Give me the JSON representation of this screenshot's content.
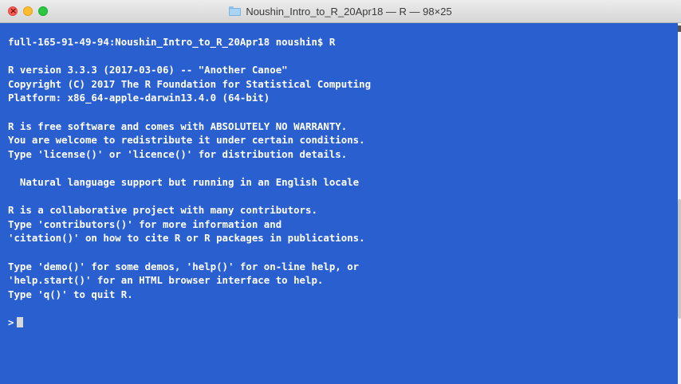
{
  "window": {
    "title": "Noushin_Intro_to_R_20Apr18 — R — 98×25",
    "title_icon": "folder-icon"
  },
  "terminal": {
    "lines": [
      "full-165-91-49-94:Noushin_Intro_to_R_20Apr18 noushin$ R",
      "",
      "R version 3.3.3 (2017-03-06) -- \"Another Canoe\"",
      "Copyright (C) 2017 The R Foundation for Statistical Computing",
      "Platform: x86_64-apple-darwin13.4.0 (64-bit)",
      "",
      "R is free software and comes with ABSOLUTELY NO WARRANTY.",
      "You are welcome to redistribute it under certain conditions.",
      "Type 'license()' or 'licence()' for distribution details.",
      "",
      "  Natural language support but running in an English locale",
      "",
      "R is a collaborative project with many contributors.",
      "Type 'contributors()' for more information and",
      "'citation()' on how to cite R or R packages in publications.",
      "",
      "Type 'demo()' for some demos, 'help()' for on-line help, or",
      "'help.start()' for an HTML browser interface to help.",
      "Type 'q()' to quit R.",
      ""
    ],
    "prompt": ">"
  },
  "colors": {
    "background": "#2a5fd0",
    "text": "#ffffff",
    "cursor": "#d8d8d8"
  }
}
